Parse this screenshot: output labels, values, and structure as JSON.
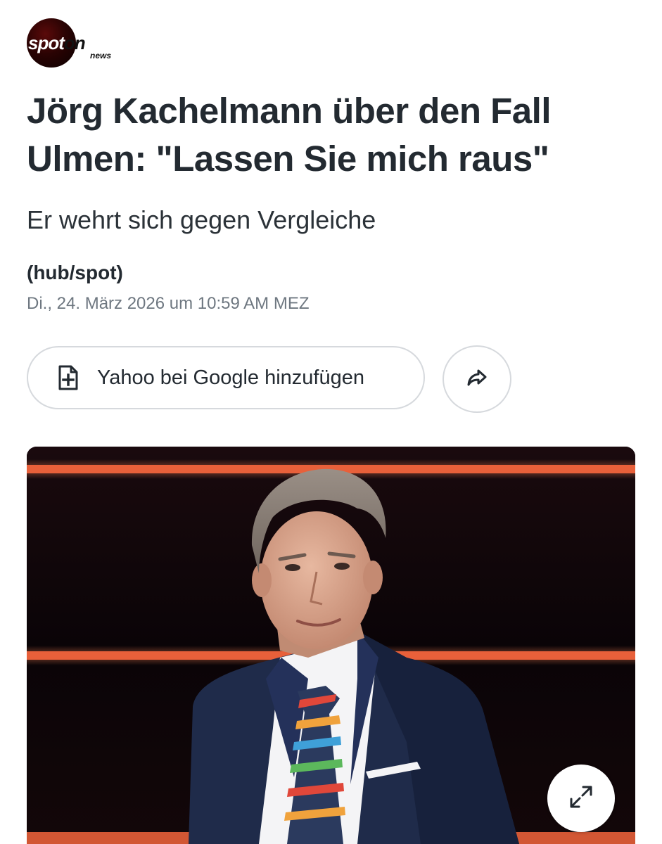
{
  "publisher": {
    "logo_text_spot": "spot",
    "logo_text_on": "on",
    "logo_text_news": "news"
  },
  "article": {
    "headline": "Jörg Kachelmann über den Fall Ulmen: \"Lassen Sie mich raus\"",
    "subheadline": "Er wehrt sich gegen Vergleiche",
    "byline": "(hub/spot)",
    "dateline": "Di., 24. März 2026 um 10:59 AM MEZ"
  },
  "actions": {
    "add_to_google_label": "Yahoo bei Google hinzufügen",
    "add_icon": "file-plus-icon",
    "share_icon": "share-arrow-icon",
    "expand_icon": "expand-arrows-icon"
  },
  "colors": {
    "text": "#232a31",
    "muted": "#6e7780",
    "border": "#d6d9dd",
    "stage_light": "#e8603a",
    "stage_background": "#0a0507",
    "suit": "#1f2b4a"
  }
}
